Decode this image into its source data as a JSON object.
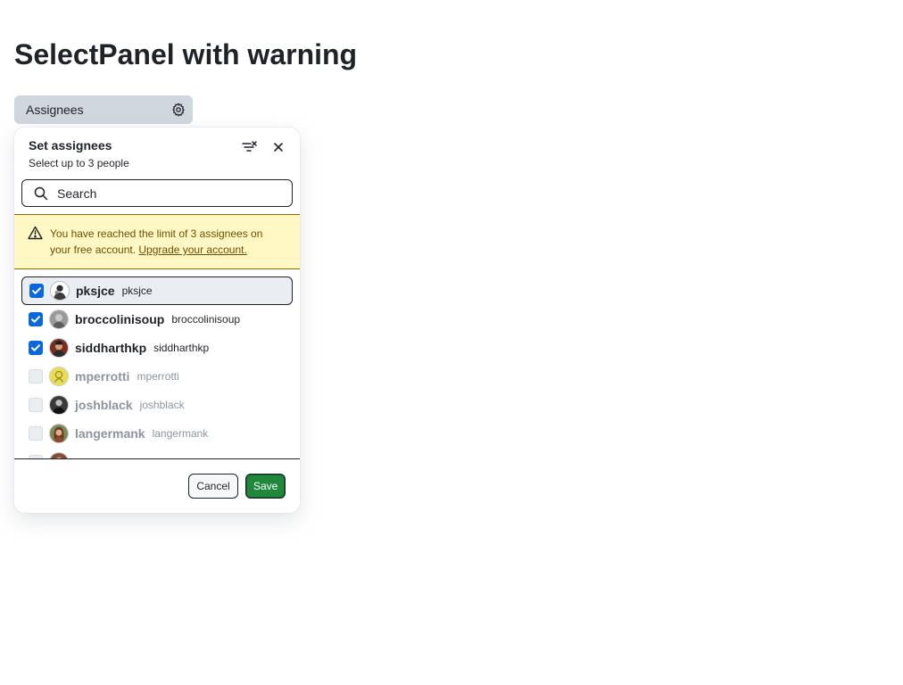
{
  "page": {
    "title": "SelectPanel with warning"
  },
  "anchor": {
    "label": "Assignees",
    "icon": "gear-icon"
  },
  "panel": {
    "title": "Set assignees",
    "subtitle": "Select up to 3 people",
    "filter_icon": "filter-remove-icon",
    "close_icon": "close-icon",
    "search": {
      "placeholder": "Search",
      "value": ""
    },
    "warning": {
      "icon": "alert-icon",
      "text": "You have reached the limit of 3 assignees on your free account. ",
      "link_text": "Upgrade your account."
    },
    "items": [
      {
        "login": "pksjce",
        "name": "pksjce",
        "checked": true,
        "disabled": false,
        "active": true
      },
      {
        "login": "broccolinisoup",
        "name": "broccolinisoup",
        "checked": true,
        "disabled": false,
        "active": false
      },
      {
        "login": "siddharthkp",
        "name": "siddharthkp",
        "checked": true,
        "disabled": false,
        "active": false
      },
      {
        "login": "mperrotti",
        "name": "mperrotti",
        "checked": false,
        "disabled": true,
        "active": false
      },
      {
        "login": "joshblack",
        "name": "joshblack",
        "checked": false,
        "disabled": true,
        "active": false
      },
      {
        "login": "langermank",
        "name": "langermank",
        "checked": false,
        "disabled": true,
        "active": false
      }
    ],
    "footer": {
      "cancel_label": "Cancel",
      "save_label": "Save"
    }
  },
  "colors": {
    "accent": "#0969da",
    "save": "#1f883d",
    "warning_bg": "#fff8c5",
    "warning_text": "#6f4e00"
  }
}
